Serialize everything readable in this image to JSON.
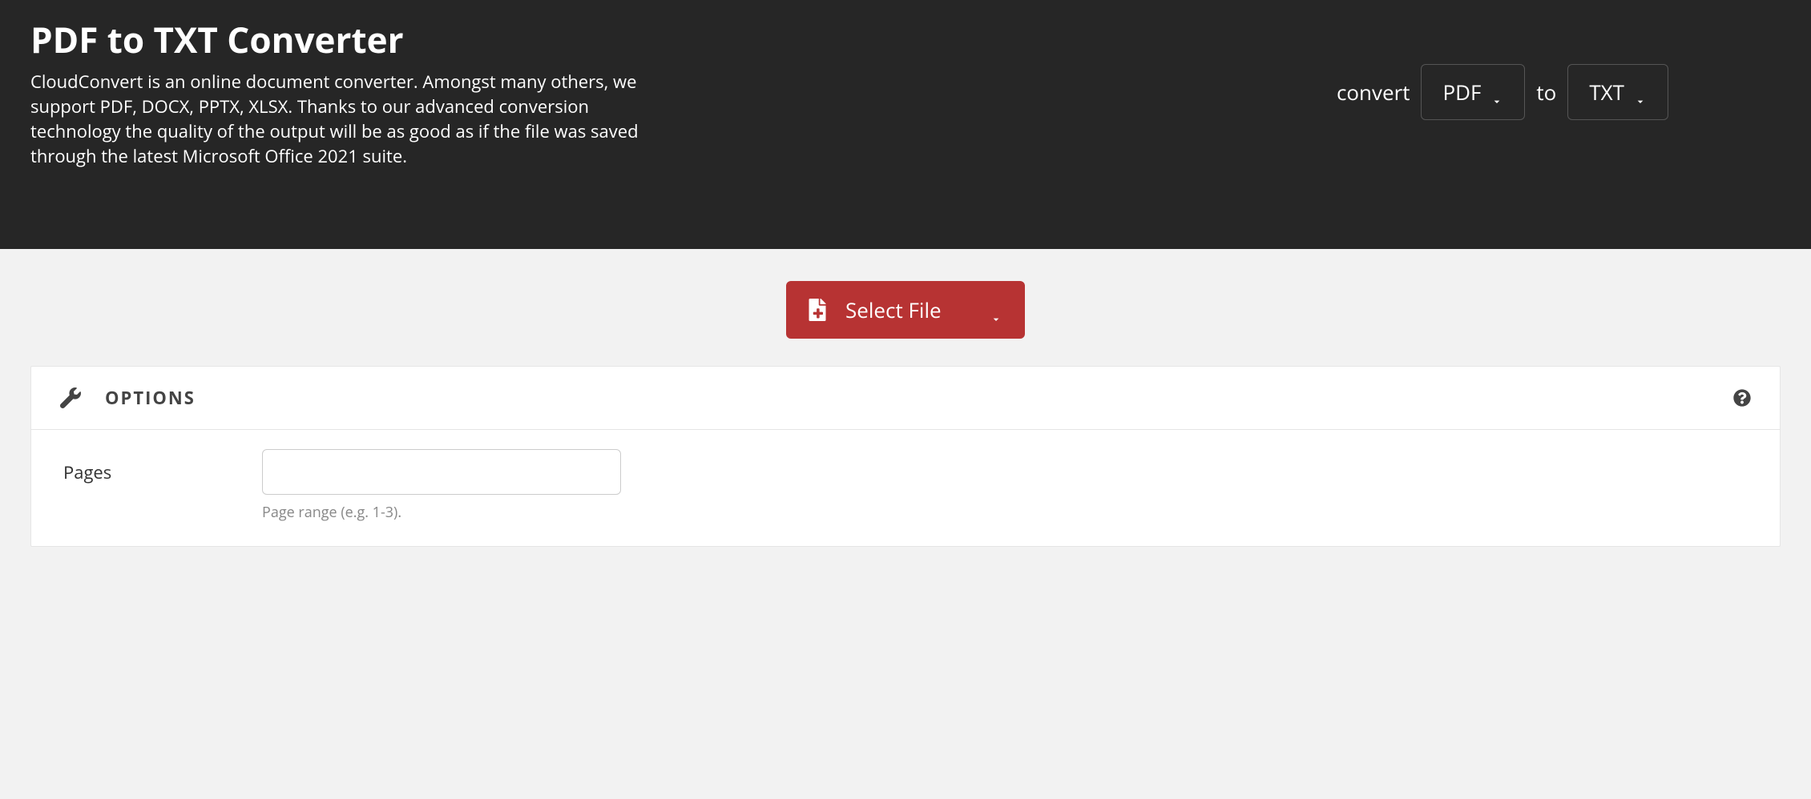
{
  "hero": {
    "title": "PDF to TXT Converter",
    "description": "CloudConvert is an online document converter. Amongst many others, we support PDF, DOCX, PPTX, XLSX. Thanks to our advanced conversion technology the quality of the output will be as good as if the file was saved through the latest Microsoft Office 2021 suite."
  },
  "converter": {
    "convert_label": "convert",
    "from_format": "PDF",
    "to_label": "to",
    "to_format": "TXT"
  },
  "select_file": {
    "label": "Select File"
  },
  "options_panel": {
    "title": "OPTIONS",
    "pages": {
      "label": "Pages",
      "value": "",
      "help": "Page range (e.g. 1-3)."
    }
  }
}
